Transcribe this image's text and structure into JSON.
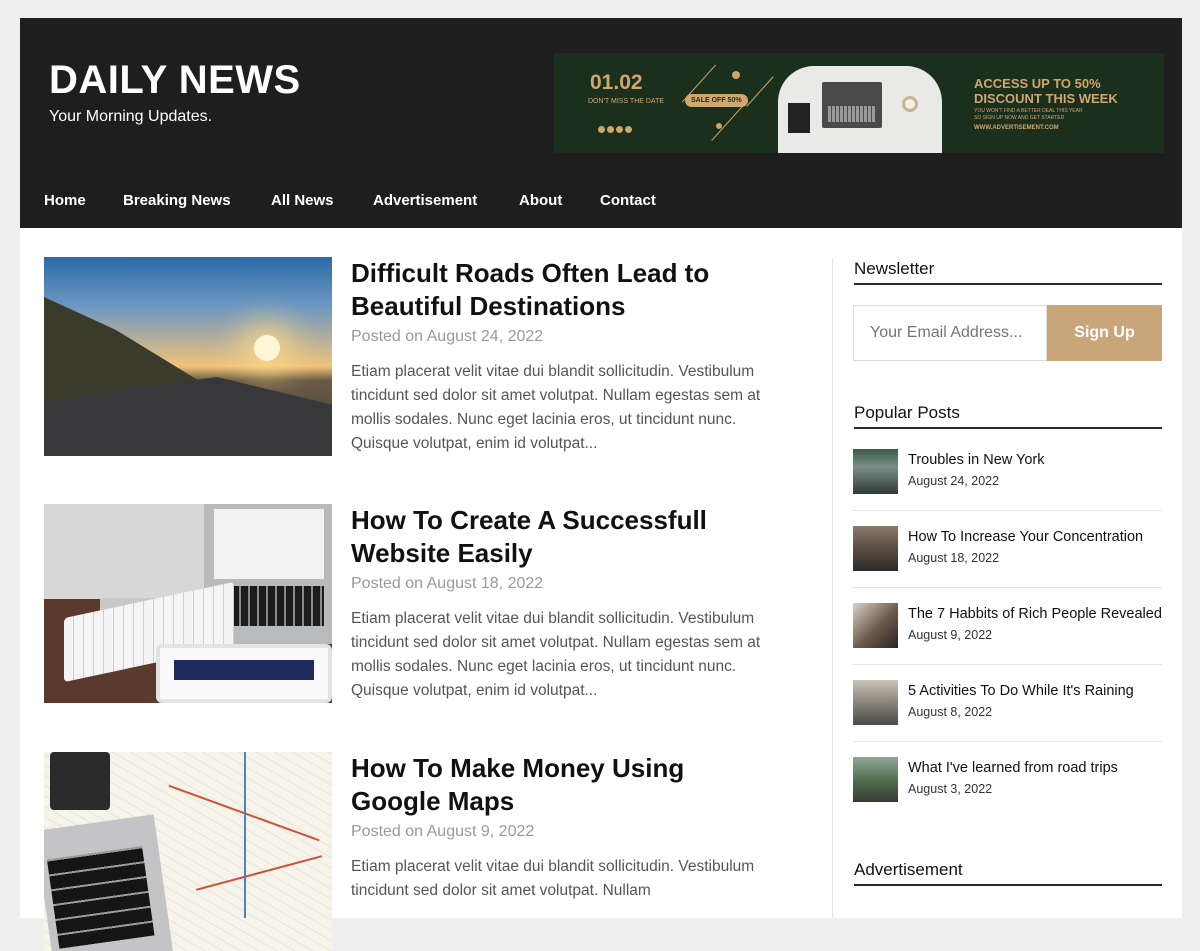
{
  "site": {
    "title": "DAILY NEWS",
    "tagline": "Your Morning Updates."
  },
  "ad": {
    "date": "01.02",
    "date_sub": "DON'T MISS THE DATE",
    "sale": "SALE OFF 50%",
    "headline_line1": "ACCESS UP TO 50%",
    "headline_line2": "DISCOUNT THIS WEEK",
    "fine_line1": "YOU WON'T FIND A BETTER DEAL THIS YEAR",
    "fine_line2": "SO SIGN UP NOW AND GET STARTED",
    "url": "WWW.ADVERTISEMENT.COM"
  },
  "nav": {
    "items": [
      "Home",
      "Breaking News",
      "All News",
      "Advertisement",
      "About",
      "Contact"
    ]
  },
  "posts": [
    {
      "title": "Difficult Roads Often Lead to Beautiful Destinations",
      "date": "Posted on August 24, 2022",
      "excerpt": "Etiam placerat velit vitae dui blandit sollicitudin. Vestibulum tincidunt sed dolor sit amet volutpat. Nullam egestas sem at mollis sodales. Nunc eget lacinia eros, ut tincidunt nunc. Quisque volutpat, enim id volutpat..."
    },
    {
      "title": "How To Create A Successfull Website Easily",
      "date": "Posted on August 18, 2022",
      "excerpt": "Etiam placerat velit vitae dui blandit sollicitudin. Vestibulum tincidunt sed dolor sit amet volutpat. Nullam egestas sem at mollis sodales. Nunc eget lacinia eros, ut tincidunt nunc. Quisque volutpat, enim id volutpat..."
    },
    {
      "title": "How To Make Money Using Google Maps",
      "date": "Posted on August 9, 2022",
      "excerpt": "Etiam placerat velit vitae dui blandit sollicitudin. Vestibulum tincidunt sed dolor sit amet volutpat. Nullam"
    }
  ],
  "sidebar": {
    "newsletter_title": "Newsletter",
    "email_placeholder": "Your Email Address...",
    "signup_label": "Sign Up",
    "popular_title": "Popular Posts",
    "popular": [
      {
        "title": "Troubles in New York",
        "date": "August 24, 2022"
      },
      {
        "title": "How To Increase Your Concentration",
        "date": "August 18, 2022"
      },
      {
        "title": "The 7 Habbits of Rich People Revealed",
        "date": "August 9, 2022"
      },
      {
        "title": "5 Activities To Do While It's Raining",
        "date": "August 8, 2022"
      },
      {
        "title": "What I've learned from road trips",
        "date": "August 3, 2022"
      }
    ],
    "ad_title": "Advertisement"
  },
  "colors": {
    "header_bg": "#1e1e1e",
    "accent": "#c9a57a",
    "ad_bg": "#1b2f1d"
  }
}
